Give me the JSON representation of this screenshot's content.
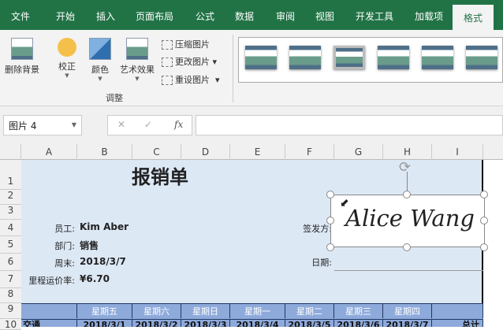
{
  "tabs": [
    "文件",
    "开始",
    "插入",
    "页面布局",
    "公式",
    "数据",
    "审阅",
    "视图",
    "开发工具",
    "加载项",
    "格式"
  ],
  "ribbon": {
    "remove_bg": "删除背景",
    "corrections": "校正",
    "color": "颜色",
    "artistic": "艺术效果",
    "compress": "压缩图片",
    "change": "更改图片",
    "reset": "重设图片",
    "group_label": "调整"
  },
  "formula_bar": {
    "name_box": "图片 4",
    "cancel": "✕",
    "enter": "✓",
    "fx": "fx",
    "value": ""
  },
  "columns": [
    "A",
    "B",
    "C",
    "D",
    "E",
    "F",
    "G",
    "H",
    "I"
  ],
  "rows": [
    "1",
    "2",
    "3",
    "4",
    "5",
    "6",
    "7",
    "8",
    "9",
    "10"
  ],
  "sheet": {
    "title": "报销单",
    "employee_label": "员工:",
    "employee": "Kim Aber",
    "dept_label": "部门:",
    "dept": "销售",
    "week_end_label": "周末:",
    "week_end": "2018/3/7",
    "mileage_label": "里程运价率:",
    "mileage": "¥6.70",
    "issuer_label": "签发方:",
    "date_label": "日期:",
    "signature": "Alice Wang",
    "weekdays": [
      "星期五",
      "星期六",
      "星期日",
      "星期一",
      "星期二",
      "星期三",
      "星期四"
    ],
    "row10_label": "交通",
    "dates": [
      "2018/3/1",
      "2018/3/2",
      "2018/3/3",
      "2018/3/4",
      "2018/3/5",
      "2018/3/6",
      "2018/3/7"
    ],
    "total": "总计"
  }
}
